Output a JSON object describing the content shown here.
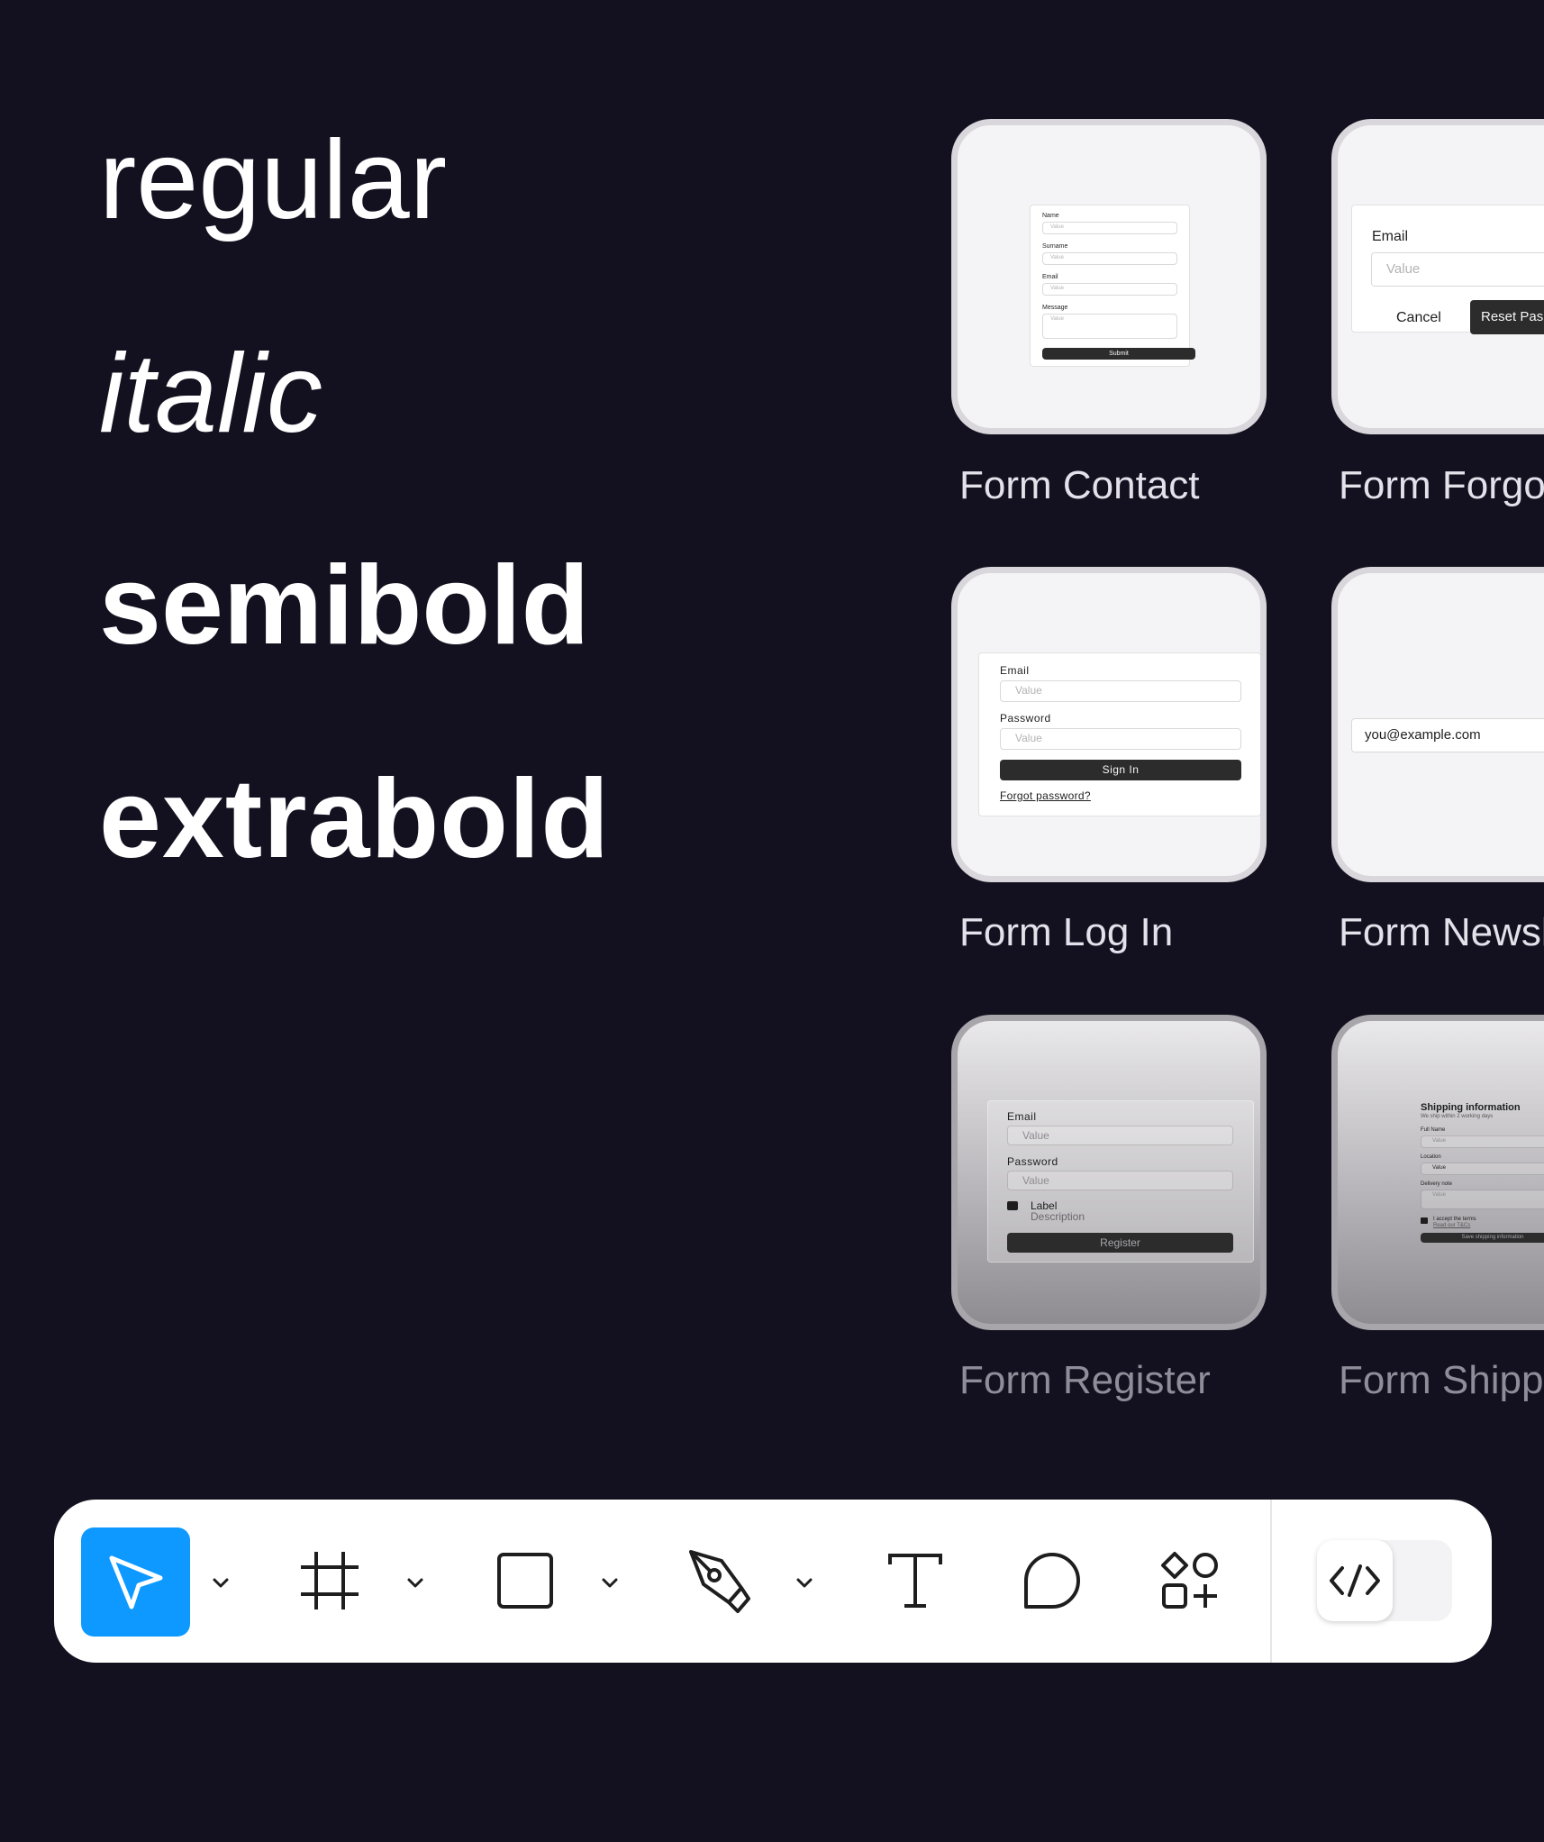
{
  "font_weights": {
    "regular": "regular",
    "italic": "italic",
    "semibold": "semibold",
    "extrabold": "extrabold"
  },
  "cards": {
    "contact": {
      "title": "Form Contact",
      "fields": [
        {
          "label": "Name",
          "placeholder": "Value"
        },
        {
          "label": "Surname",
          "placeholder": "Value"
        },
        {
          "label": "Email",
          "placeholder": "Value"
        },
        {
          "label": "Message",
          "placeholder": "Value"
        }
      ],
      "submit": "Submit"
    },
    "forgot": {
      "title": "Form Forgot",
      "email_label": "Email",
      "email_placeholder": "Value",
      "cancel": "Cancel",
      "reset": "Reset Pas"
    },
    "login": {
      "title": "Form Log In",
      "email_label": "Email",
      "email_placeholder": "Value",
      "password_label": "Password",
      "password_placeholder": "Value",
      "sign_in": "Sign In",
      "forgot_link": "Forgot password?"
    },
    "newsletter": {
      "title": "Form Newsl",
      "email_value": "you@example.com"
    },
    "register": {
      "title": "Form Register",
      "email_label": "Email",
      "email_placeholder": "Value",
      "password_label": "Password",
      "password_placeholder": "Value",
      "checkbox_label": "Label",
      "checkbox_description": "Description",
      "register": "Register"
    },
    "shipping": {
      "title": "Form Shippi",
      "heading": "Shipping information",
      "subheading": "We ship within 2 working days",
      "full_name_label": "Full Name",
      "full_name_placeholder": "Value",
      "location_label": "Location",
      "location_value": "Value",
      "delivery_label": "Delivery note",
      "delivery_placeholder": "Value",
      "terms_label": "I accept the terms",
      "terms_link": "Read our T&Cs",
      "submit": "Save shipping information"
    }
  },
  "toolbar": {
    "tools": [
      "move-tool",
      "frame-tool",
      "rectangle-tool",
      "pen-tool",
      "text-tool",
      "comment-tool",
      "actions-tool"
    ],
    "accent_color": "#0d99ff",
    "dev_mode": "code-icon"
  }
}
